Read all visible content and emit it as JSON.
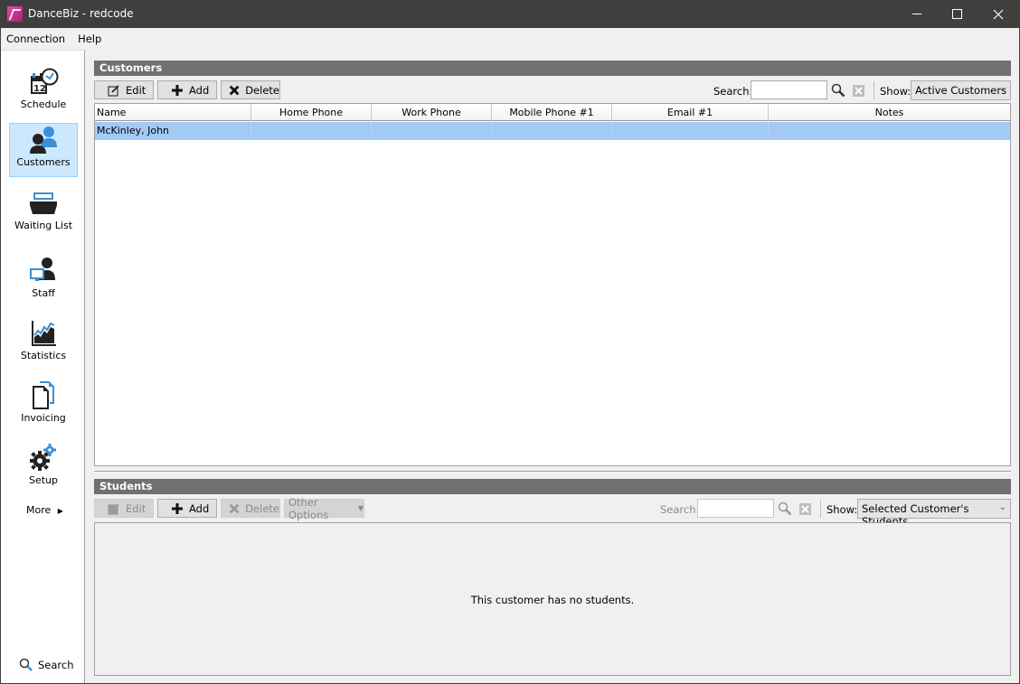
{
  "window": {
    "title": "DanceBiz - redcode",
    "controls": [
      "minimize",
      "maximize",
      "close"
    ]
  },
  "menu": [
    "Connection",
    "Help"
  ],
  "sidebar": {
    "items": [
      {
        "label": "Schedule",
        "icon": "calendar-clock-icon",
        "active": false
      },
      {
        "label": "Customers",
        "icon": "customers-icon",
        "active": true
      },
      {
        "label": "Waiting List",
        "icon": "basket-icon",
        "active": false
      },
      {
        "label": "Staff",
        "icon": "staff-icon",
        "active": false
      },
      {
        "label": "Statistics",
        "icon": "chart-icon",
        "active": false
      },
      {
        "label": "Invoicing",
        "icon": "documents-icon",
        "active": false
      },
      {
        "label": "Setup",
        "icon": "gears-icon",
        "active": false
      }
    ],
    "more_label": "More",
    "search_label": "Search"
  },
  "customers": {
    "header": "Customers",
    "buttons": {
      "edit": "Edit",
      "add": "Add",
      "delete": "Delete"
    },
    "search_label": "Search:",
    "search_value": "",
    "show_label": "Show:",
    "show_value": "Active Customers",
    "columns": [
      "Name",
      "Home Phone",
      "Work Phone",
      "Mobile Phone #1",
      "Email #1",
      "Notes"
    ],
    "rows": [
      {
        "name": "McKinley, John",
        "home_phone": "",
        "work_phone": "",
        "mobile_phone": "",
        "email": "",
        "notes": "",
        "selected": true
      }
    ]
  },
  "students": {
    "header": "Students",
    "buttons": {
      "edit": "Edit",
      "add": "Add",
      "delete": "Delete",
      "other": "Other Options"
    },
    "search_label": "Search:",
    "search_value": "",
    "show_label": "Show:",
    "show_value": "Selected Customer's Students",
    "empty_message": "This customer has no students."
  },
  "colors": {
    "selection": "#a3c9f5",
    "active_nav": "#cce8ff",
    "panel_header": "#707070",
    "accent_blue": "#3a8fd6"
  }
}
